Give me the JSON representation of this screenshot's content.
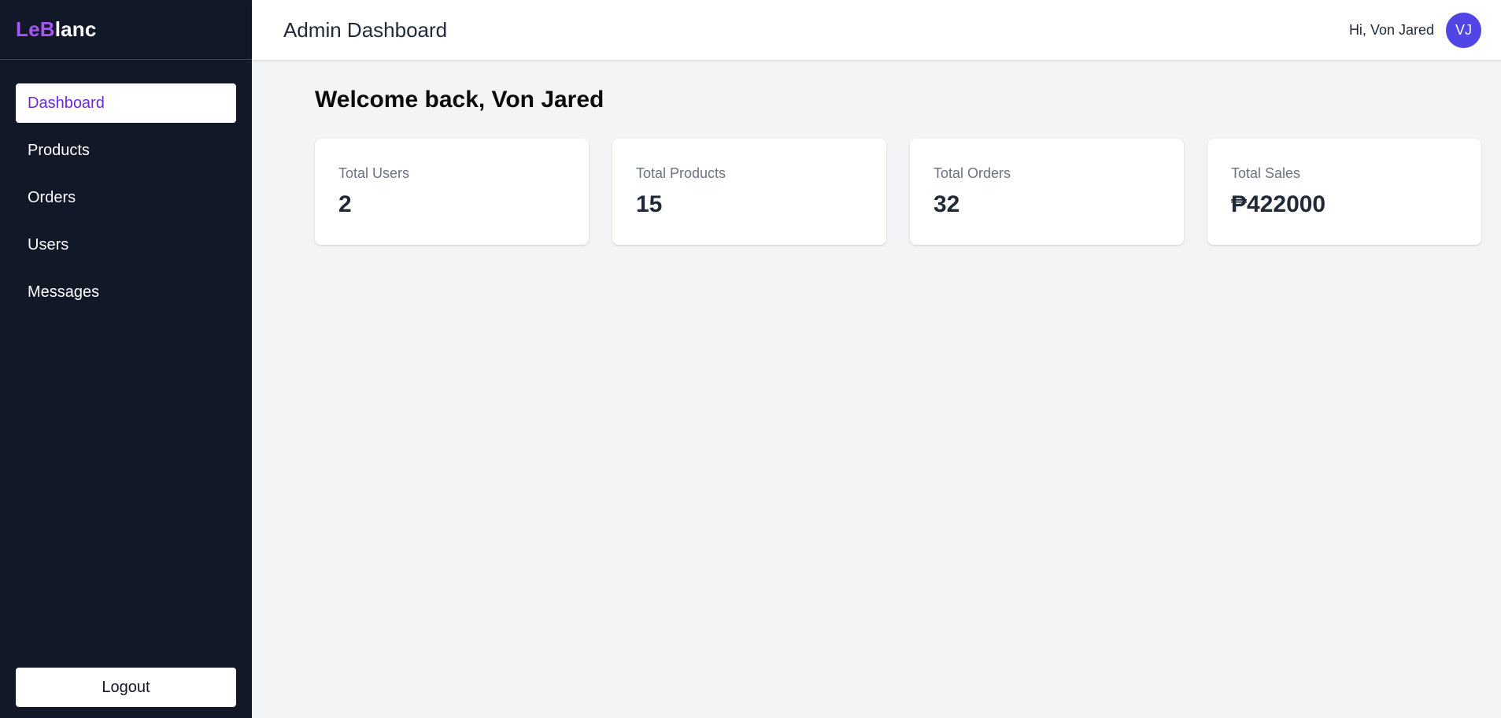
{
  "brand": {
    "accent": "LeB",
    "rest": "lanc",
    "accent_color": "#a855f7"
  },
  "sidebar": {
    "items": [
      {
        "label": "Dashboard",
        "active": true
      },
      {
        "label": "Products",
        "active": false
      },
      {
        "label": "Orders",
        "active": false
      },
      {
        "label": "Users",
        "active": false
      },
      {
        "label": "Messages",
        "active": false
      }
    ],
    "logout_label": "Logout"
  },
  "header": {
    "title": "Admin Dashboard",
    "greeting": "Hi, Von Jared",
    "avatar_initials": "VJ",
    "avatar_color": "#4f46e5"
  },
  "main": {
    "welcome": "Welcome back, Von Jared",
    "stats": [
      {
        "label": "Total Users",
        "value": "2"
      },
      {
        "label": "Total Products",
        "value": "15"
      },
      {
        "label": "Total Orders",
        "value": "32"
      },
      {
        "label": "Total Sales",
        "value": "₱422000"
      }
    ]
  },
  "colors": {
    "sidebar_bg": "#111827",
    "active_text": "#6d28d9",
    "page_bg": "#f3f4f6"
  }
}
